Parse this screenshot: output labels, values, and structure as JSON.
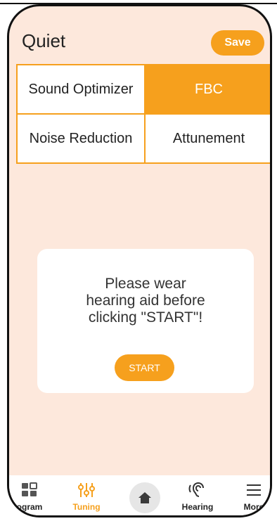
{
  "header": {
    "title": "Quiet",
    "save_label": "Save"
  },
  "options": [
    {
      "label": "Sound Optimizer",
      "active": false
    },
    {
      "label": "FBC",
      "active": true
    },
    {
      "label": "Noise Reduction",
      "active": false
    },
    {
      "label": "Attunement",
      "active": false
    }
  ],
  "dialog": {
    "message_line1": "Please wear",
    "message_line2": "hearing aid before",
    "message_line3": "clicking \"START\"!",
    "start_label": "START"
  },
  "tabs": [
    {
      "label": "ogram",
      "icon": "grid-icon"
    },
    {
      "label": "Tuning",
      "icon": "sliders-icon",
      "active": true
    },
    {
      "label": "",
      "icon": "home-icon"
    },
    {
      "label": "Hearing",
      "icon": "ear-icon"
    },
    {
      "label": "More",
      "icon": "list-icon"
    }
  ],
  "colors": {
    "accent": "#f6a01d",
    "background": "#fde8dc"
  }
}
